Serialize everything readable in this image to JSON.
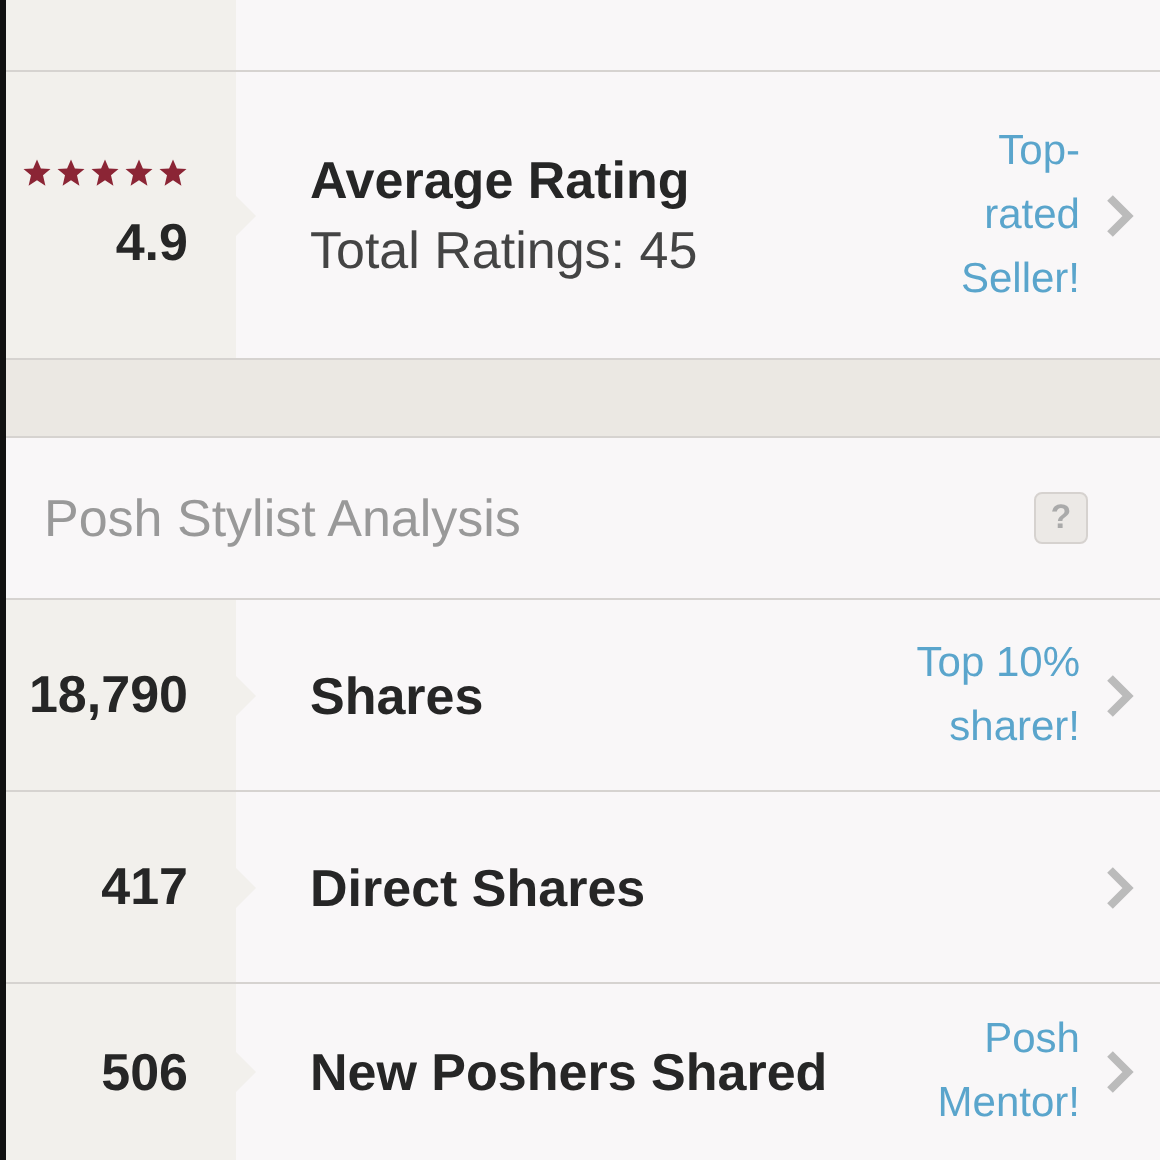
{
  "rating": {
    "stars": 5,
    "score": "4.9",
    "title": "Average Rating",
    "subtitle": "Total Ratings: 45",
    "badge": "Top-rated Seller!"
  },
  "section": {
    "title": "Posh Stylist Analysis",
    "help": "?"
  },
  "stats": [
    {
      "value": "18,790",
      "label": "Shares",
      "badge": "Top 10% sharer!"
    },
    {
      "value": "417",
      "label": "Direct Shares"
    },
    {
      "value": "506",
      "label": "New Poshers Shared",
      "badge": "Posh Mentor!"
    }
  ]
}
